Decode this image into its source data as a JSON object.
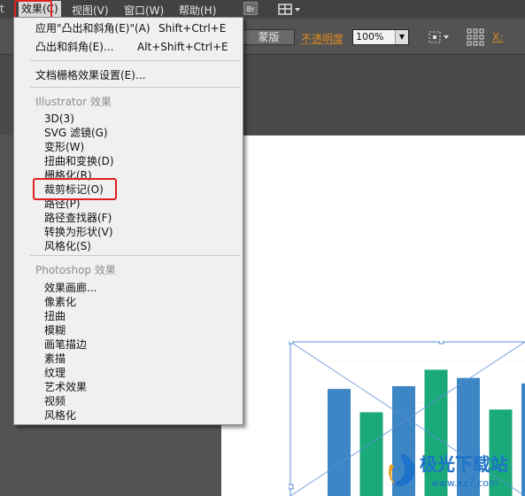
{
  "menubar": {
    "items": [
      {
        "label": "效果(C)",
        "active": true
      },
      {
        "label": "视图(V)"
      },
      {
        "label": "窗口(W)"
      },
      {
        "label": "帮助(H)"
      }
    ],
    "bridge_badge": "Br",
    "left_cut": "t"
  },
  "control_bar": {
    "style_button": "蒙版",
    "opacity_label": "不透明度",
    "opacity_value": "100%",
    "x_label": "X:"
  },
  "effect_menu": {
    "top_items": [
      {
        "label": "应用\"凸出和斜角(E)\"(A)",
        "shortcut": "Shift+Ctrl+E"
      },
      {
        "label": "凸出和斜角(E)...",
        "shortcut": "Alt+Shift+Ctrl+E"
      }
    ],
    "document_raster": "文档栅格效果设置(E)...",
    "illustrator_header": "Illustrator 效果",
    "illustrator_items": [
      "3D(3)",
      "SVG 滤镜(G)",
      "变形(W)",
      "扭曲和变换(D)",
      "栅格化(R)",
      "裁剪标记(O)",
      "路径(P)",
      "路径查找器(F)",
      "转换为形状(V)",
      "风格化(S)"
    ],
    "photoshop_header": "Photoshop 效果",
    "photoshop_items": [
      "效果画廊...",
      "像素化",
      "扭曲",
      "模糊",
      "画笔描边",
      "素描",
      "纹理",
      "艺术效果",
      "视频",
      "风格化"
    ],
    "highlighted_item": "裁剪标记(O)"
  },
  "chart_data": {
    "type": "bar",
    "title": "",
    "y_tick_labels": [
      "",
      "",
      "",
      ""
    ],
    "series": [
      {
        "values": [
          0.78,
          0.61,
          0.8,
          0.92,
          0.86,
          0.63,
          0.82
        ]
      }
    ],
    "colors": [
      "#3d86c6",
      "#1aaa7a"
    ]
  },
  "watermark": {
    "brand": "极光下载站",
    "url": "www.xz7.com"
  },
  "colors": {
    "highlight_red": "#e02020",
    "accent_orange": "#e08a1e"
  }
}
